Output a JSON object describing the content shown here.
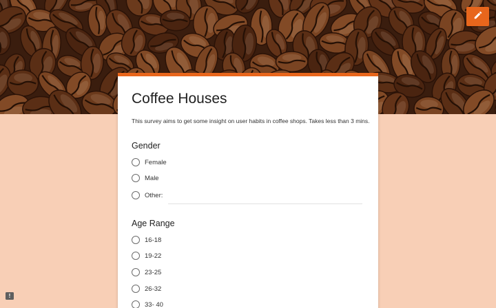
{
  "form": {
    "title": "Coffee Houses",
    "description": "This survey aims to get some insight on user habits in coffee shops. Takes less than 3 mins."
  },
  "questions": [
    {
      "title": "Gender",
      "options": [
        "Female",
        "Male",
        "Other:"
      ]
    },
    {
      "title": "Age Range",
      "options": [
        "16-18",
        "19-22",
        "23-25",
        "26-32",
        "33- 40"
      ]
    }
  ],
  "other_input": {
    "value": ""
  },
  "icons": {
    "edit": "pencil-icon",
    "feedback": "feedback-icon",
    "feedback_glyph": "!"
  },
  "colors": {
    "accent": "#e8661c",
    "background": "#f8cfb6",
    "card": "#ffffff"
  }
}
